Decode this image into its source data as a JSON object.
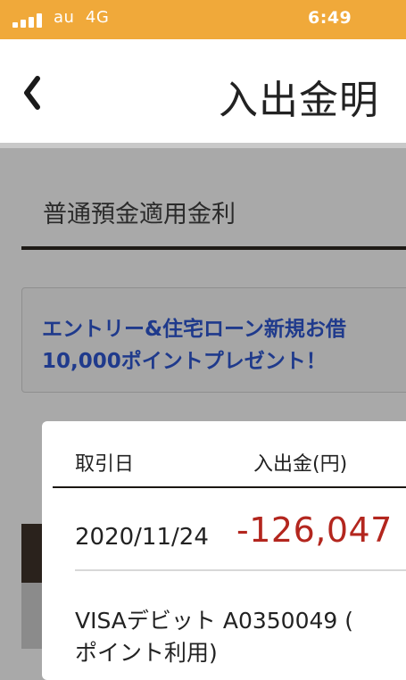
{
  "status_bar": {
    "carrier": "au",
    "network": "4G",
    "time": "6:49"
  },
  "nav": {
    "title": "入出金明"
  },
  "section": {
    "heading": "普通預金適用金利"
  },
  "promo": {
    "line1": "エントリー&住宅ローン新規お借",
    "line2": "10,000ポイントプレゼント！"
  },
  "popup": {
    "col_date": "取引日",
    "col_amount": "入出金(円)",
    "transaction": {
      "date": "2020/11/24",
      "amount": "-126,047",
      "description_line1": "VISAデビット A0350049 (",
      "description_line2": "ポイント利用)"
    }
  },
  "colors": {
    "status_bar": "#f0a93a",
    "promo_text": "#1f3a8c",
    "debit_amount": "#b3261e"
  }
}
